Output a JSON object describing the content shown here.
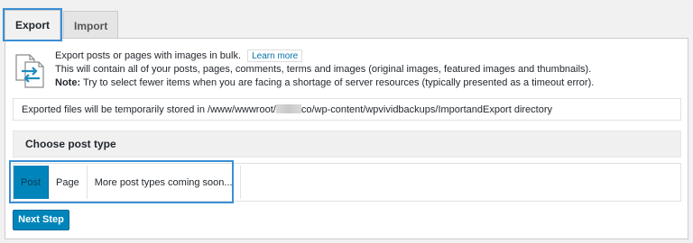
{
  "tabs": [
    {
      "label": "Export",
      "active": true
    },
    {
      "label": "Import",
      "active": false
    }
  ],
  "info": {
    "line1": "Export posts or pages with images in bulk.",
    "learn_more": "Learn more",
    "line2": "This will contain all of your posts, pages, comments, terms and images (original images, featured images and thumbnails).",
    "note_label": "Note:",
    "note_text": " Try to select fewer items when you are facing a shortage of server resources (typically presented as a timeout error).",
    "icon": "export-documents-icon"
  },
  "storage": {
    "prefix": "Exported files will be temporarily stored in /www/wwwroot/",
    "suffix": "co/wp-content/wpvividbackups/ImportandExport directory"
  },
  "post_type": {
    "header": "Choose post type",
    "options": [
      "Post",
      "Page"
    ],
    "selected": "Post",
    "coming_soon": "More post types coming soon..."
  },
  "actions": {
    "next_step": "Next Step"
  },
  "colors": {
    "primary": "#0085ba",
    "highlight": "#3a8ed6",
    "link": "#0073aa"
  }
}
